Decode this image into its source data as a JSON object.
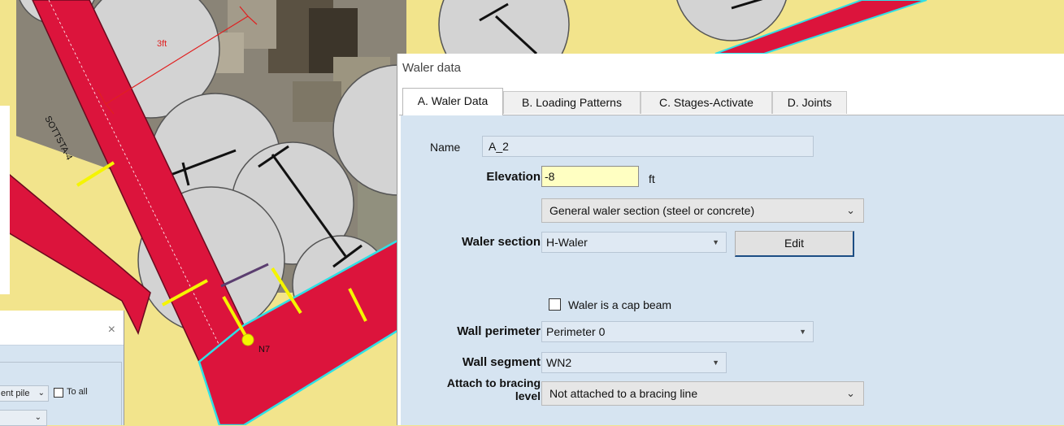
{
  "canvas": {
    "dimension_label": "3ft",
    "node_label": "N7",
    "rotated_label": "SOTTSTA-4"
  },
  "dialog": {
    "title": "Waler data",
    "tabs": [
      {
        "label": "A. Waler Data",
        "active": true
      },
      {
        "label": "B. Loading Patterns",
        "active": false
      },
      {
        "label": "C. Stages-Activate",
        "active": false
      },
      {
        "label": "D. Joints",
        "active": false
      }
    ],
    "form": {
      "name_label": "Name",
      "name_value": "A_2",
      "elevation_label": "Elevation",
      "elevation_value": "-8",
      "elevation_unit": "ft",
      "section_type": "General waler section (steel or concrete)",
      "waler_section_label": "Waler section",
      "waler_section_value": "H-Waler",
      "edit_button": "Edit",
      "cap_beam_label": "Waler is a cap beam",
      "cap_beam_checked": false,
      "wall_perimeter_label": "Wall perimeter",
      "wall_perimeter_value": "Perimeter 0",
      "wall_segment_label": "Wall segment",
      "wall_segment_value": "WN2",
      "attach_label_line1": "Attach to bracing",
      "attach_label_line2": "level",
      "attach_value": "Not attached to a bracing line"
    }
  },
  "mini_dialog": {
    "close_icon": "×",
    "select_partial": "ent pile",
    "to_all_label": "To all"
  },
  "colors": {
    "background_yellow": "#f2e48c",
    "member_red": "#dc143c",
    "cyan_outline": "#2fe0e6",
    "panel_blue": "#d6e4f1",
    "highlight_yellow": "#ffffc2"
  }
}
